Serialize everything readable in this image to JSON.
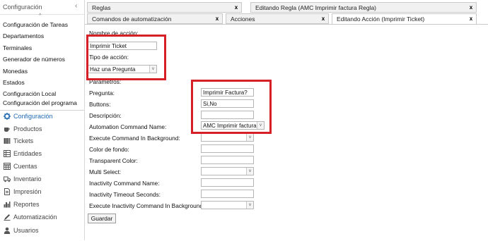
{
  "sidebar": {
    "header_title": "Configuración",
    "header_toggle": "‹",
    "scroll_up": "^",
    "sub_items": [
      {
        "label": "Configuración de Tareas"
      },
      {
        "label": "Departamentos"
      },
      {
        "label": "Terminales"
      },
      {
        "label": "Generador de números"
      },
      {
        "label": "Monedas"
      },
      {
        "label": "Estados"
      },
      {
        "label": "Configuración Local"
      }
    ],
    "clipped_item": "Configuración del programa",
    "main_items": [
      {
        "label": "Configuración",
        "icon": "gear-icon"
      },
      {
        "label": "Productos",
        "icon": "coffee-cup-icon"
      },
      {
        "label": "Tickets",
        "icon": "tickets-icon"
      },
      {
        "label": "Entidades",
        "icon": "table-icon"
      },
      {
        "label": "Cuentas",
        "icon": "calendar-grid-icon"
      },
      {
        "label": "Inventario",
        "icon": "truck-icon"
      },
      {
        "label": "Impresión",
        "icon": "document-icon"
      },
      {
        "label": "Reportes",
        "icon": "bar-chart-icon"
      },
      {
        "label": "Automatización",
        "icon": "pen-icon"
      },
      {
        "label": "Usuarios",
        "icon": "user-icon"
      }
    ],
    "colors": {
      "active": "#1d69b1"
    }
  },
  "tabs_row1": [
    {
      "label": "Reglas",
      "close": "x"
    },
    {
      "label": "Editando Regla (AMC Imprimir factura Regla)",
      "close": "x"
    }
  ],
  "tabs_row2": [
    {
      "label": "Comandos de automatización",
      "close": "x"
    },
    {
      "label": "Acciones",
      "close": "x"
    },
    {
      "label": "Editando Acción (Imprimir Ticket)",
      "close": "x"
    }
  ],
  "form": {
    "name_label": "Nombre de acción:",
    "name_value": "Imprimir Ticket",
    "type_label": "Tipo de acción:",
    "type_value": "Haz una Pregunta",
    "params_label": "Parámetros:",
    "fields": [
      {
        "label": "Pregunta:",
        "value": "Imprimir Factura?",
        "kind": "text"
      },
      {
        "label": "Buttons:",
        "value": "Si,No",
        "kind": "text"
      },
      {
        "label": "Descripción:",
        "value": "",
        "kind": "text"
      },
      {
        "label": "Automation Command Name:",
        "value": "AMC Imprimir factura",
        "kind": "select"
      },
      {
        "label": "Execute Command In Background:",
        "value": "",
        "kind": "select"
      },
      {
        "label": "Color de fondo:",
        "value": "",
        "kind": "text"
      },
      {
        "label": "Transparent Color:",
        "value": "",
        "kind": "text"
      },
      {
        "label": "Multi Select:",
        "value": "",
        "kind": "select"
      },
      {
        "label": "Inactivity Command Name:",
        "value": "",
        "kind": "text"
      },
      {
        "label": "Inactivity Timeout Seconds:",
        "value": "",
        "kind": "text"
      },
      {
        "label": "Execute Inactivity Command In Background:",
        "value": "",
        "kind": "select"
      }
    ],
    "save_label": "Guardar",
    "dropdown_arrow": "v"
  },
  "highlight_color": "#d61f26"
}
